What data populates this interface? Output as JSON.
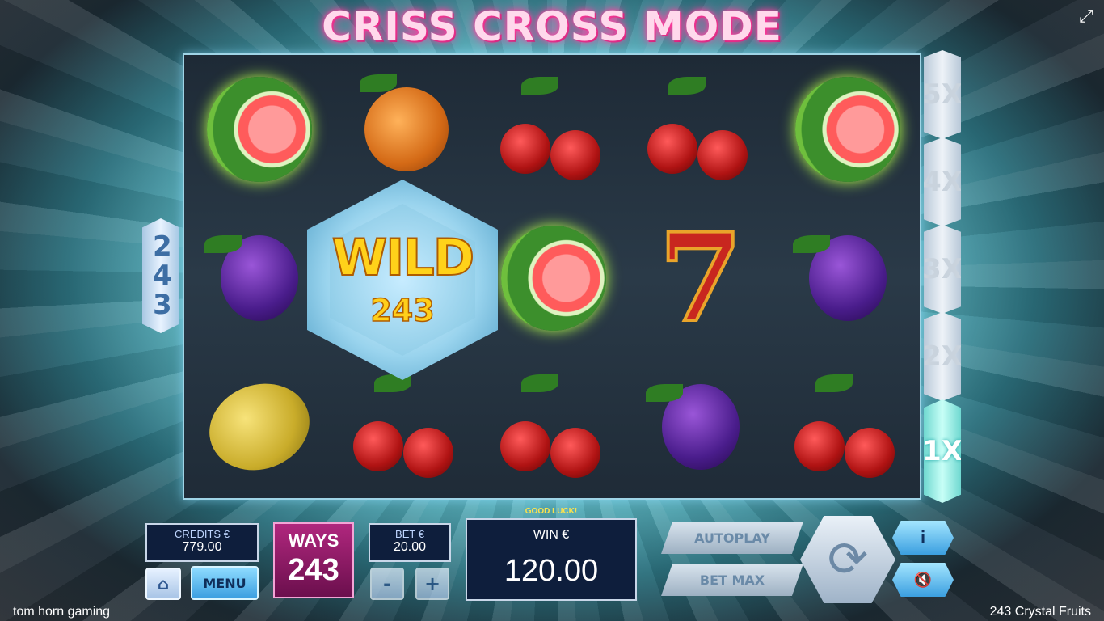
{
  "header": {
    "title": "CRISS CROSS MODE",
    "fullscreen_icon": "expand-icon"
  },
  "reels": {
    "symbols": [
      [
        "watermelon",
        "orange",
        "cherries",
        "cherries",
        "watermelon"
      ],
      [
        "plum",
        "wild",
        "watermelon",
        "seven",
        "plum"
      ],
      [
        "lemon",
        "cherries",
        "cherries",
        "plum",
        "cherries"
      ]
    ],
    "seven_label": "7",
    "wild": {
      "word": "WILD",
      "value": "243"
    }
  },
  "ways_side": {
    "label": "243"
  },
  "multipliers": [
    "5X",
    "4X",
    "3X",
    "2X",
    "1X"
  ],
  "multiplier_active": "1X",
  "bottom": {
    "credits_label": "CREDITS €",
    "credits_value": "779.00",
    "ways_label": "WAYS",
    "ways_value": "243",
    "bet_label": "BET €",
    "bet_value": "20.00",
    "minus": "-",
    "plus": "+",
    "menu_label": "MENU",
    "good_luck": "GOOD LUCK!",
    "win_label": "WIN €",
    "win_value": "120.00",
    "autoplay_label": "AUTOPLAY",
    "betmax_label": "BET MAX",
    "info_label": "i",
    "sound_icon": "mute-icon",
    "home_icon": "home-icon",
    "spin_icon": "spin-icon"
  },
  "footer": {
    "left": "tom horn gaming",
    "right": "243 Crystal Fruits"
  }
}
